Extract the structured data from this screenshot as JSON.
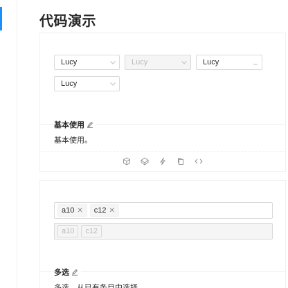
{
  "page": {
    "title": "代码演示",
    "accent_color": "#1890ff"
  },
  "demo_basic": {
    "selects": [
      {
        "value": "Lucy",
        "state": "normal",
        "icon": "chevron-down-icon"
      },
      {
        "value": "Lucy",
        "state": "disabled",
        "icon": "chevron-down-icon"
      },
      {
        "value": "Lucy",
        "state": "loading",
        "icon": "loading-icon"
      },
      {
        "value": "Lucy",
        "state": "normal",
        "icon": "chevron-down-icon"
      }
    ],
    "title": "基本使用",
    "description": "基本使用。",
    "actions": [
      "codesandbox-icon",
      "codepen-icon",
      "riddle-icon",
      "copy-icon",
      "code-expand-icon"
    ]
  },
  "demo_multiple": {
    "select": {
      "tags": [
        "a10",
        "c12"
      ]
    },
    "select_disabled": {
      "tags": [
        "a10",
        "c12"
      ]
    },
    "title": "多选",
    "description": "多选，从已有条目中选择。"
  }
}
